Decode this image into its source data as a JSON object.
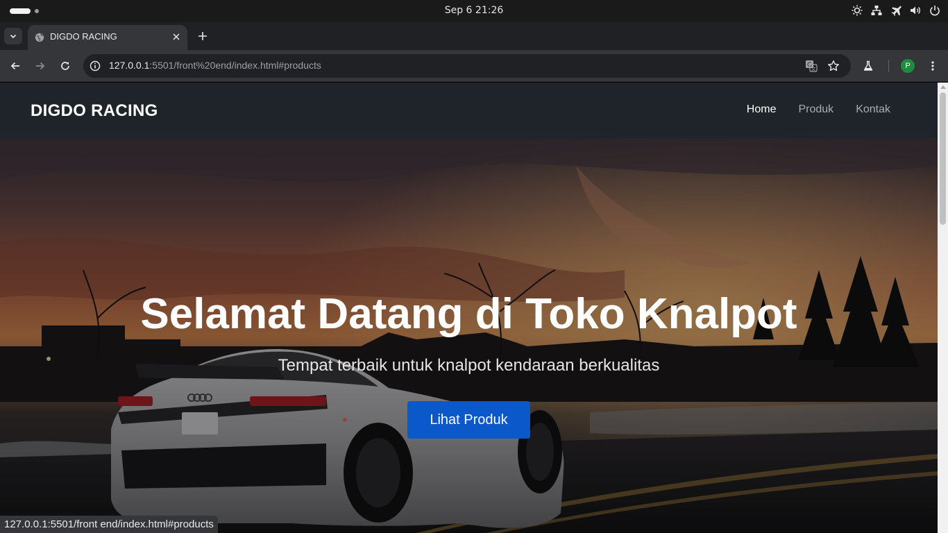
{
  "os": {
    "clock": "Sep 6  21:26",
    "tray_icons": [
      "brightness-icon",
      "network-icon",
      "airplane-mode-icon",
      "volume-icon",
      "power-icon"
    ]
  },
  "browser": {
    "tab": {
      "title": "DIGDO RACING",
      "favicon": "globe-icon"
    },
    "url": {
      "host": "127.0.0.1",
      "rest": ":5501/front%20end/index.html#products"
    },
    "profile_initial": "P",
    "status_url": "127.0.0.1:5501/front end/index.html#products"
  },
  "site": {
    "logo": "DIGDO RACING",
    "nav": [
      {
        "label": "Home",
        "active": true
      },
      {
        "label": "Produk",
        "active": false
      },
      {
        "label": "Kontak",
        "active": false
      }
    ],
    "hero": {
      "title": "Selamat Datang di Toko Knalpot",
      "subtitle": "Tempat terbaik untuk knalpot kendaraan berkualitas",
      "cta": "Lihat Produk"
    }
  },
  "colors": {
    "nav_bg": "#1f242b",
    "cta_bg": "#0a58ca",
    "profile_bg": "#1e8e3e"
  }
}
